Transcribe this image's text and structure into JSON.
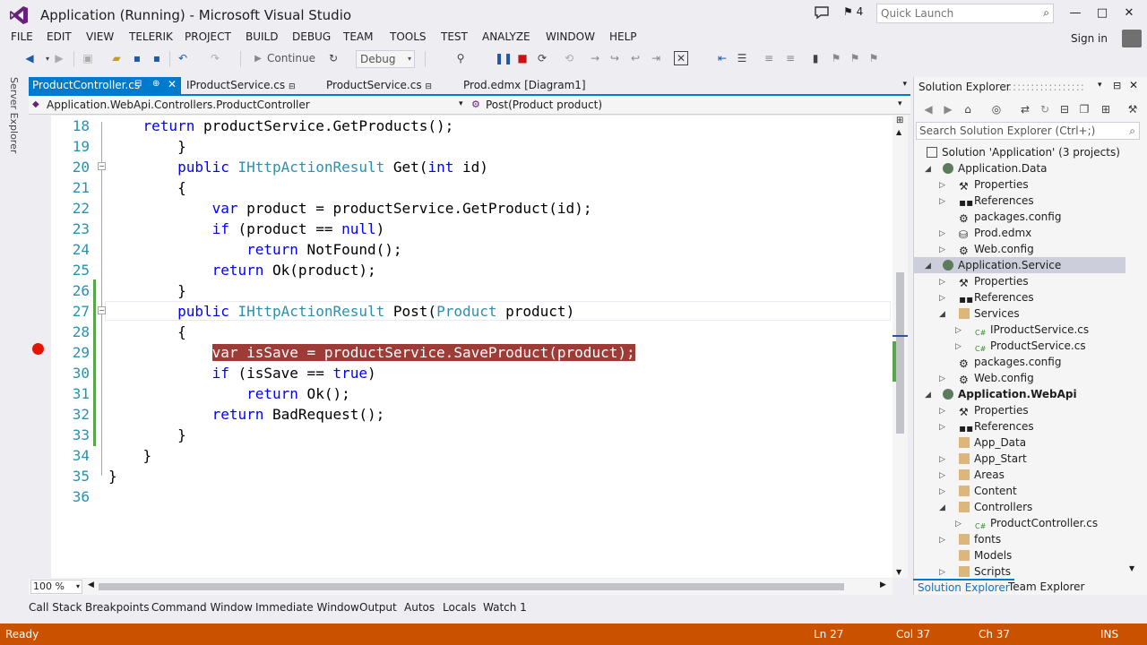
{
  "window": {
    "title": "Application (Running) - Microsoft Visual Studio",
    "notification_count": "4",
    "quick_launch_placeholder": "Quick Launch",
    "sign_in": "Sign in"
  },
  "menu": [
    "FILE",
    "EDIT",
    "VIEW",
    "TELERIK",
    "PROJECT",
    "BUILD",
    "DEBUG",
    "TEAM",
    "TOOLS",
    "TEST",
    "ANALYZE",
    "WINDOW",
    "HELP"
  ],
  "toolbar": {
    "continue_label": "Continue",
    "configuration": "Debug"
  },
  "server_explorer_label": "Server Explorer",
  "doc_tabs": [
    {
      "label": "ProductController.cs"
    },
    {
      "label": "IProductService.cs"
    },
    {
      "label": "ProductService.cs"
    },
    {
      "label": "Prod.edmx [Diagram1]"
    }
  ],
  "nav": {
    "type_selector": "Application.WebApi.Controllers.ProductController",
    "member_selector": "Post(Product product)"
  },
  "code_lines": [
    {
      "n": "18",
      "text": "            return productService.GetProducts();"
    },
    {
      "n": "19",
      "text": "        }"
    },
    {
      "n": "20",
      "text": "        public IHttpActionResult Get(int id)"
    },
    {
      "n": "21",
      "text": "        {"
    },
    {
      "n": "22",
      "text": "            var product = productService.GetProduct(id);"
    },
    {
      "n": "23",
      "text": "            if (product == null)"
    },
    {
      "n": "24",
      "text": "                return NotFound();"
    },
    {
      "n": "25",
      "text": "            return Ok(product);"
    },
    {
      "n": "26",
      "text": "        }"
    },
    {
      "n": "27",
      "text": "        public IHttpActionResult Post(Product product)"
    },
    {
      "n": "28",
      "text": "        {"
    },
    {
      "n": "29",
      "text": "            var isSave = productService.SaveProduct(product);"
    },
    {
      "n": "30",
      "text": "            if (isSave == true)"
    },
    {
      "n": "31",
      "text": "                return Ok();"
    },
    {
      "n": "32",
      "text": "            return BadRequest();"
    },
    {
      "n": "33",
      "text": "        }"
    },
    {
      "n": "34",
      "text": "    }"
    },
    {
      "n": "35",
      "text": "}"
    },
    {
      "n": "36",
      "text": ""
    }
  ],
  "zoom": "100 %",
  "solution_explorer": {
    "title": "Solution Explorer",
    "search_placeholder": "Search Solution Explorer (Ctrl+;)",
    "items": [
      {
        "label": "Solution 'Application' (3 projects)"
      },
      {
        "label": "Application.Data"
      },
      {
        "label": "Properties"
      },
      {
        "label": "References"
      },
      {
        "label": "packages.config"
      },
      {
        "label": "Prod.edmx"
      },
      {
        "label": "Web.config"
      },
      {
        "label": "Application.Service"
      },
      {
        "label": "Properties"
      },
      {
        "label": "References"
      },
      {
        "label": "Services"
      },
      {
        "label": "IProductService.cs"
      },
      {
        "label": "ProductService.cs"
      },
      {
        "label": "packages.config"
      },
      {
        "label": "Web.config"
      },
      {
        "label": "Application.WebApi"
      },
      {
        "label": "Properties"
      },
      {
        "label": "References"
      },
      {
        "label": "App_Data"
      },
      {
        "label": "App_Start"
      },
      {
        "label": "Areas"
      },
      {
        "label": "Content"
      },
      {
        "label": "Controllers"
      },
      {
        "label": "ProductController.cs"
      },
      {
        "label": "fonts"
      },
      {
        "label": "Models"
      },
      {
        "label": "Scripts"
      }
    ],
    "tab_solution": "Solution Explorer",
    "tab_team": "Team Explorer"
  },
  "tool_tabs": [
    "Call Stack",
    "Breakpoints",
    "Command Window",
    "Immediate Window",
    "Output",
    "Autos",
    "Locals",
    "Watch 1"
  ],
  "status": {
    "state": "Ready",
    "ln": "Ln 27",
    "col": "Col 37",
    "ch": "Ch 37",
    "mode": "INS"
  },
  "colors": {
    "accent": "#007acc",
    "status_bar": "#ca5100",
    "breakpoint": "#e51400",
    "breakpoint_highlight": "#9d3b37"
  }
}
